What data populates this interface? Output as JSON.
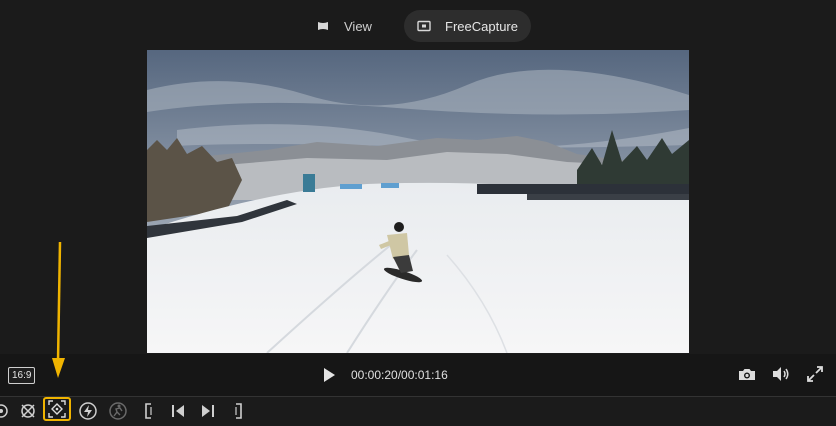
{
  "tabs": [
    {
      "label": "View",
      "icon": "film-frame-icon",
      "active": false
    },
    {
      "label": "FreeCapture",
      "icon": "capture-box-icon",
      "active": true
    }
  ],
  "player": {
    "aspect_ratio": "16:9",
    "time": "00:00:20/00:01:16",
    "play_icon": "play-icon",
    "snapshot_icon": "camera-icon",
    "volume_icon": "volume-icon",
    "fullscreen_icon": "fullscreen-icon"
  },
  "toolbar": {
    "tools": [
      "partial-tool-icon",
      "remove-target-icon",
      "auto-focus-target-icon",
      "flash-icon",
      "motion-runner-icon",
      "mark-in-icon",
      "previous-frame-icon",
      "next-frame-icon",
      "mark-out-icon"
    ],
    "highlighted_tool": "auto-focus-target-icon",
    "highlight_color": "#f0b400"
  },
  "annotation": {
    "arrow_color": "#f0b400"
  },
  "video": {
    "scene": "snowboarder descending snowy slope with mountains"
  }
}
